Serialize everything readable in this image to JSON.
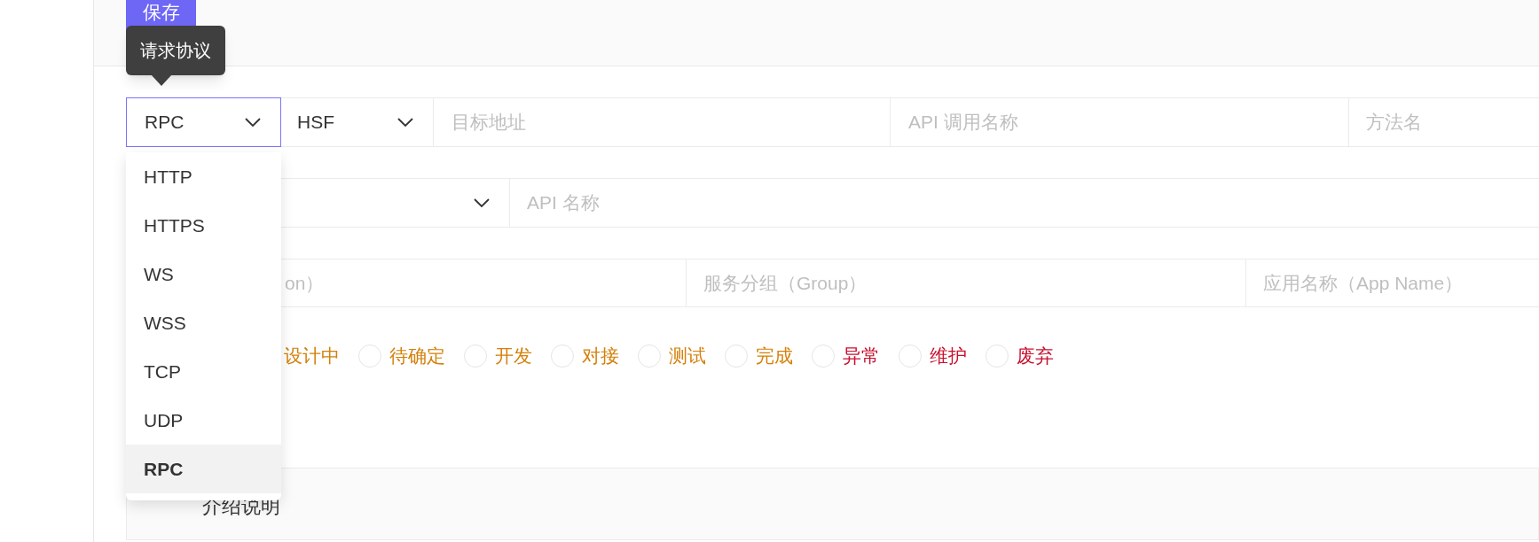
{
  "toolbar": {
    "save_button": "保存"
  },
  "tooltip": "请求协议",
  "row_1": {
    "protocol_select": "RPC",
    "type_select": "HSF",
    "fields": [
      {
        "placeholder": "目标地址"
      },
      {
        "placeholder": "API 调用名称"
      },
      {
        "placeholder": "方法名"
      }
    ]
  },
  "row_2": {
    "field": {
      "placeholder": "API 名称"
    }
  },
  "row_3": {
    "fields": [
      {
        "placeholder": "on）"
      },
      {
        "placeholder": "服务分组（Group）"
      },
      {
        "placeholder": "应用名称（App Name）"
      }
    ]
  },
  "status_options": [
    {
      "kind": "label",
      "label": "设计中",
      "color": "#d4800a",
      "selected": false
    },
    {
      "kind": "radio",
      "label": "待确定",
      "color": "#d4800a",
      "selected": false
    },
    {
      "kind": "radio",
      "label": "开发",
      "color": "#d4800a",
      "selected": false
    },
    {
      "kind": "radio",
      "label": "对接",
      "color": "#d4800a",
      "selected": false
    },
    {
      "kind": "radio",
      "label": "测试",
      "color": "#d4800a",
      "selected": false
    },
    {
      "kind": "radio",
      "label": "完成",
      "color": "#d4800a",
      "selected": false
    },
    {
      "kind": "radio",
      "label": "异常",
      "color": "#c8102e",
      "selected": false
    },
    {
      "kind": "radio",
      "label": "维护",
      "color": "#c8102e",
      "selected": false
    },
    {
      "kind": "radio",
      "label": "废弃",
      "color": "#c8102e",
      "selected": false
    }
  ],
  "section_title": "介绍说明",
  "dropdown": [
    {
      "label": "HTTP",
      "selected": false
    },
    {
      "label": "HTTPS",
      "selected": false
    },
    {
      "label": "WS",
      "selected": false
    },
    {
      "label": "WSS",
      "selected": false
    },
    {
      "label": "TCP",
      "selected": false
    },
    {
      "label": "UDP",
      "selected": false
    },
    {
      "label": "RPC",
      "selected": true
    }
  ]
}
